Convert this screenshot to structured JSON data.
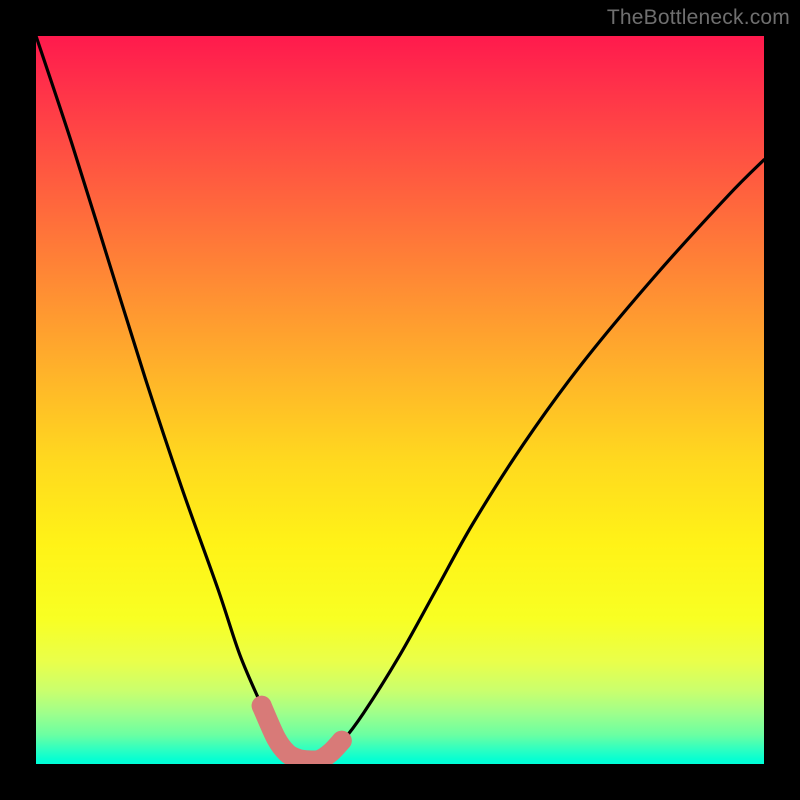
{
  "watermark": "TheBottleneck.com",
  "colors": {
    "frame": "#000000",
    "curve": "#000000",
    "marker": "#d87a78",
    "gradient_top": "#ff1a4d",
    "gradient_bottom": "#00ffd9"
  },
  "chart_data": {
    "type": "line",
    "title": "",
    "xlabel": "",
    "ylabel": "",
    "xlim": [
      0,
      100
    ],
    "ylim": [
      0,
      100
    ],
    "axes_visible": false,
    "grid": false,
    "legend": false,
    "background": "vertical-gradient (red → orange → yellow → green)",
    "series": [
      {
        "name": "bottleneck-curve",
        "x": [
          0,
          5,
          10,
          15,
          20,
          25,
          28,
          31,
          33,
          35,
          36.5,
          38,
          40,
          42,
          45,
          50,
          55,
          60,
          67,
          75,
          85,
          95,
          100
        ],
        "values": [
          100,
          85,
          69,
          53,
          38,
          24,
          15,
          8,
          3.5,
          1,
          0.5,
          0.5,
          1.2,
          3,
          7,
          15,
          24,
          33,
          44,
          55,
          67,
          78,
          83
        ]
      }
    ],
    "markers": {
      "name": "optimal-range-highlight",
      "x": [
        31,
        33,
        34.5,
        36,
        37.5,
        39,
        40.5,
        42
      ],
      "values": [
        8,
        3.5,
        1.5,
        0.7,
        0.5,
        0.6,
        1.6,
        3.2
      ]
    }
  }
}
